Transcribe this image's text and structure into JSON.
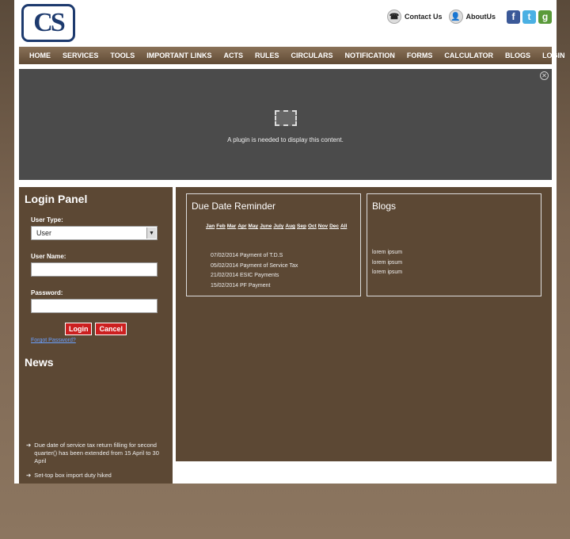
{
  "header": {
    "logo_text": "CS",
    "contact_label": "Contact Us",
    "about_label": "AboutUs",
    "social": [
      "f",
      "t",
      "g"
    ]
  },
  "nav": [
    "HOME",
    "SERVICES",
    "TOOLS",
    "IMPORTANT LINKS",
    "ACTS",
    "RULES",
    "CIRCULARS",
    "NOTIFICATION",
    "FORMS",
    "CALCULATOR",
    "BLOGS",
    "LOGIN"
  ],
  "plugin": {
    "message": "A plugin is needed to display this content."
  },
  "login": {
    "title": "Login Panel",
    "user_type_label": "User Type:",
    "user_type_value": "User",
    "username_label": "User Name:",
    "password_label": "Password:",
    "login_btn": "Login",
    "cancel_btn": "Cancel",
    "forgot": "Forgot Password?"
  },
  "news": {
    "title": "News",
    "item1_a": "Due date of service tax return filling for second quarter(",
    "item1_red": "",
    "item1_b": ") has been extended from 15 April to 30 April",
    "item2": "Set-top box import duty hiked"
  },
  "due": {
    "title": "Due Date Reminder",
    "months": [
      "Jan",
      "Feb",
      "Mar",
      "Apr",
      "May",
      "June",
      "July",
      "Aug",
      "Sep",
      "Oct",
      "Nov",
      "Dec",
      "All"
    ],
    "items": [
      "07/02/2014 Payment of T.D.S",
      "05/02/2014 Payment of Service Tax",
      "21/02/2014 ESIC Payments",
      "15/02/2014 PF Payment"
    ]
  },
  "blogs": {
    "title": "Blogs",
    "items": [
      "lorem ipsum",
      "lorem ipsum",
      "lorem ipsum"
    ]
  }
}
